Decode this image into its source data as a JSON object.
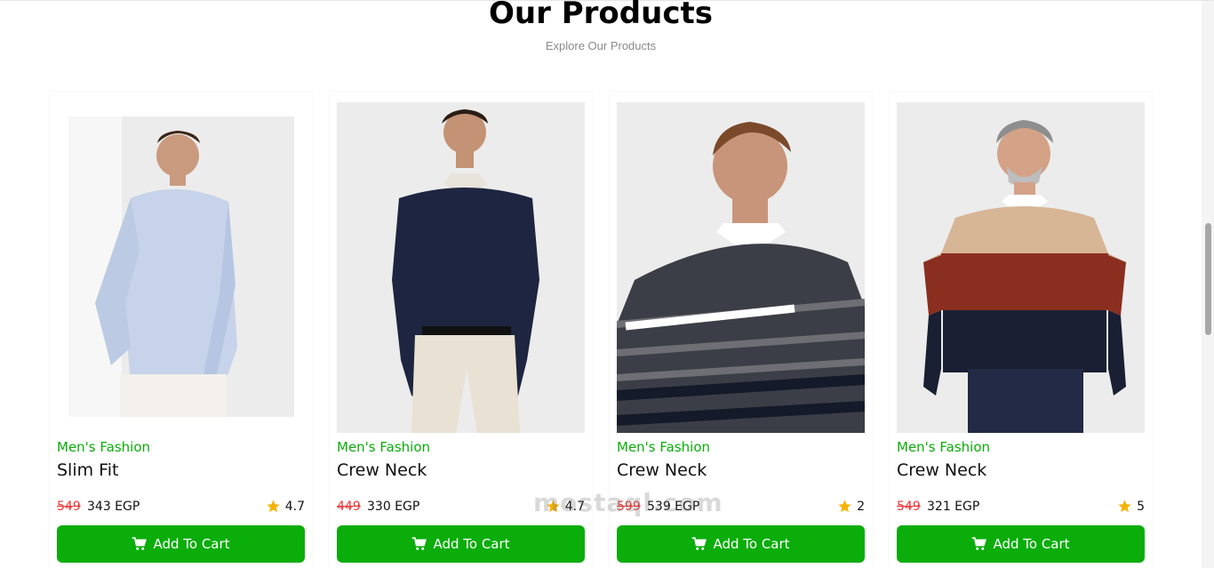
{
  "section": {
    "title": "Our Products",
    "subtitle": "Explore Our Products"
  },
  "colors": {
    "accent": "#0aad0a",
    "old_price": "#ee3333",
    "star": "#f5b301"
  },
  "products": [
    {
      "category": "Men's Fashion",
      "name": "Slim Fit",
      "old_price": "549",
      "price": "343 EGP",
      "rating": "4.7",
      "button": "Add To Cart"
    },
    {
      "category": "Men's Fashion",
      "name": "Crew Neck",
      "old_price": "449",
      "price": "330 EGP",
      "rating": "4.7",
      "button": "Add To Cart"
    },
    {
      "category": "Men's Fashion",
      "name": "Crew Neck",
      "old_price": "599",
      "price": "539 EGP",
      "rating": "2",
      "button": "Add To Cart"
    },
    {
      "category": "Men's Fashion",
      "name": "Crew Neck",
      "old_price": "549",
      "price": "321 EGP",
      "rating": "5",
      "button": "Add To Cart"
    }
  ],
  "watermark": "mostaql.com"
}
